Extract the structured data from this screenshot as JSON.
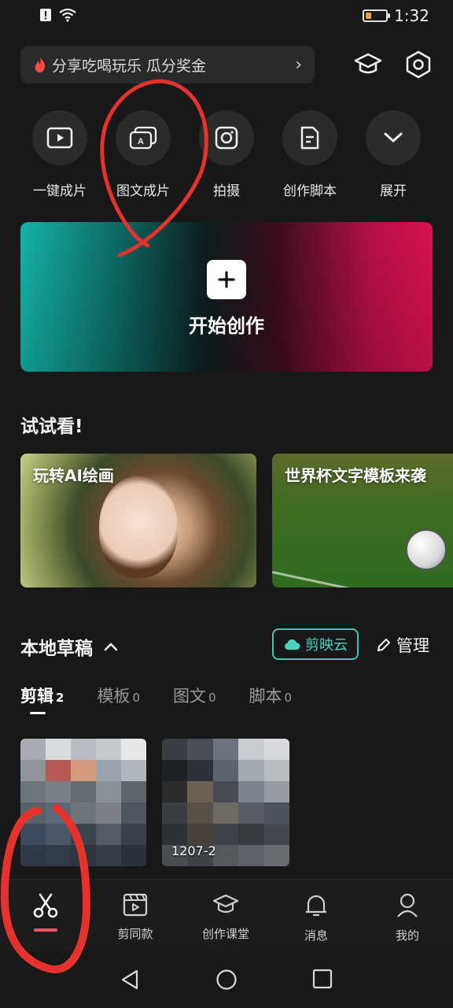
{
  "status_bar": {
    "time": "1:32",
    "battery_level": 0.2,
    "icons": [
      "alert-icon",
      "wifi-icon",
      "battery-icon"
    ]
  },
  "promo": {
    "text": "分享吃喝玩乐 瓜分奖金"
  },
  "header_icons": [
    "graduation-cap-icon",
    "settings-icon"
  ],
  "quick_actions": [
    {
      "label": "一键成片",
      "icon": "play-icon"
    },
    {
      "label": "图文成片",
      "icon": "image-text-icon"
    },
    {
      "label": "拍摄",
      "icon": "camera-icon"
    },
    {
      "label": "创作脚本",
      "icon": "script-icon"
    },
    {
      "label": "展开",
      "icon": "chevron-down-icon"
    }
  ],
  "hero": {
    "title": "开始创作"
  },
  "try_section": {
    "title": "试试看!",
    "cards": [
      {
        "title": "玩转AI绘画"
      },
      {
        "title": "世界杯文字模板来袭"
      }
    ]
  },
  "drafts": {
    "title": "本地草稿",
    "cloud_label": "剪映云",
    "manage_label": "管理",
    "tabs": [
      {
        "label": "剪辑",
        "count": "2",
        "active": true
      },
      {
        "label": "模板",
        "count": "0",
        "active": false
      },
      {
        "label": "图文",
        "count": "0",
        "active": false
      },
      {
        "label": "脚本",
        "count": "0",
        "active": false
      }
    ],
    "items": [
      {
        "label": ""
      },
      {
        "label": "1207-2"
      }
    ]
  },
  "bottom_nav": [
    {
      "label": "",
      "icon": "scissors-icon",
      "active": true
    },
    {
      "label": "剪同款",
      "icon": "clapperboard-icon",
      "active": false
    },
    {
      "label": "创作课堂",
      "icon": "graduation-cap-icon",
      "active": false
    },
    {
      "label": "消息",
      "icon": "bell-icon",
      "active": false
    },
    {
      "label": "我的",
      "icon": "user-icon",
      "active": false
    }
  ],
  "colors": {
    "background": "#181818",
    "accent_teal": "#3fc6b5",
    "accent_pink": "#f0566b",
    "annotation_red": "#e5322d"
  }
}
